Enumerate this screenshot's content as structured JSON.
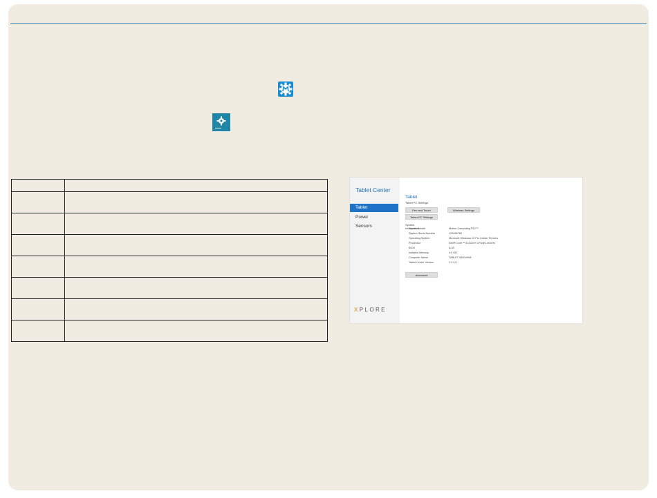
{
  "page": {
    "rule_color": "#2f7fb3"
  },
  "icons": [
    {
      "name": "settings-gear-m-icon",
      "color": "#1a8ccf"
    },
    {
      "name": "tablet-center-tile-icon",
      "color": "#1f86a8"
    }
  ],
  "spec_table": {
    "row_count": 8
  },
  "tablet_center": {
    "title": "Tablet Center",
    "nav": [
      {
        "label": "Tablet",
        "selected": true
      },
      {
        "label": "Power",
        "selected": false
      },
      {
        "label": "Sensors",
        "selected": false
      }
    ],
    "brand": {
      "prefix": "X",
      "rest": "PLORE"
    },
    "heading": "Tablet",
    "subheading": "Tablet PC Settings",
    "buttons": {
      "pen_touch": "Pen and Touch",
      "wireless": "Wireless Settings",
      "tablet_pc": "Tablet PC Settings",
      "advanced": "Advanced"
    },
    "system_info_heading": "System Information",
    "system_info": [
      {
        "label": "System Model",
        "value": "Motion Computing R12™"
      },
      {
        "label": "System Serial Number",
        "value": "123456789"
      },
      {
        "label": "Operating System",
        "value": "Microsoft Windows 10 Pro Insider Preview"
      },
      {
        "label": "Processor",
        "value": "Intel® Core™ i5-4220Y CPU@1.60GHz"
      },
      {
        "label": "BIOS",
        "value": "A.00"
      },
      {
        "label": "Installed Memory",
        "value": "4.0 GB"
      },
      {
        "label": "Computer Name",
        "value": "TABLET-6390JH08"
      },
      {
        "label": "Tablet Center Version",
        "value": "1.2.0.0"
      }
    ]
  }
}
